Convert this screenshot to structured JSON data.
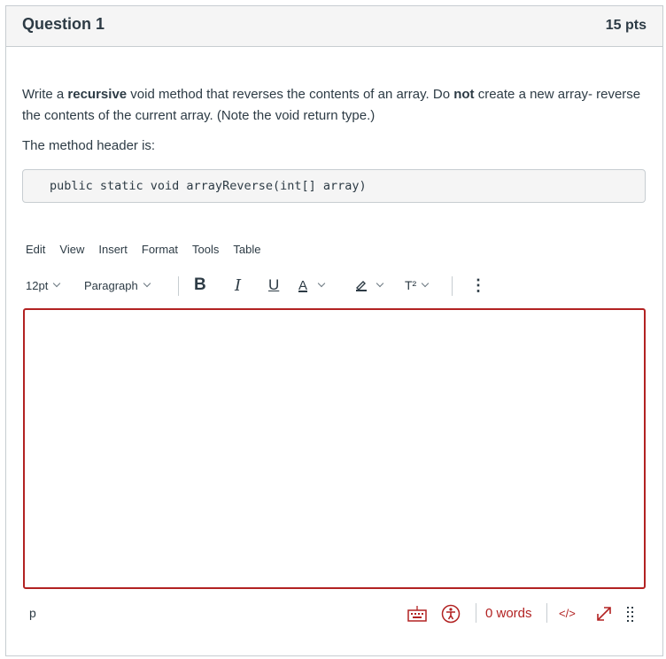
{
  "question": {
    "title": "Question 1",
    "points": "15 pts",
    "prompt": {
      "p1": "Write a ",
      "b1": "recursive",
      "p2": " void method that reverses the contents of an array. Do ",
      "b2": "not",
      "p3": " create a new array- reverse the contents of the current array. (Note the void return type.)"
    },
    "header_label": "The method header is:",
    "code": "public static void arrayReverse(int[] array)"
  },
  "editor": {
    "menu": [
      "Edit",
      "View",
      "Insert",
      "Format",
      "Tools",
      "Table"
    ],
    "toolbar": {
      "font_size": "12pt",
      "block_format": "Paragraph",
      "bold": "B",
      "italic": "I",
      "underline": "U",
      "text_color": "A",
      "superscript": "T²",
      "more": "⋮"
    },
    "content": "",
    "status": {
      "path": "p",
      "word_count": "0 words",
      "html_toggle": "</>"
    }
  },
  "colors": {
    "accent": "#b22222",
    "text": "#2d3b45",
    "header_bg": "#f5f5f5",
    "border": "#c7cdd1"
  }
}
